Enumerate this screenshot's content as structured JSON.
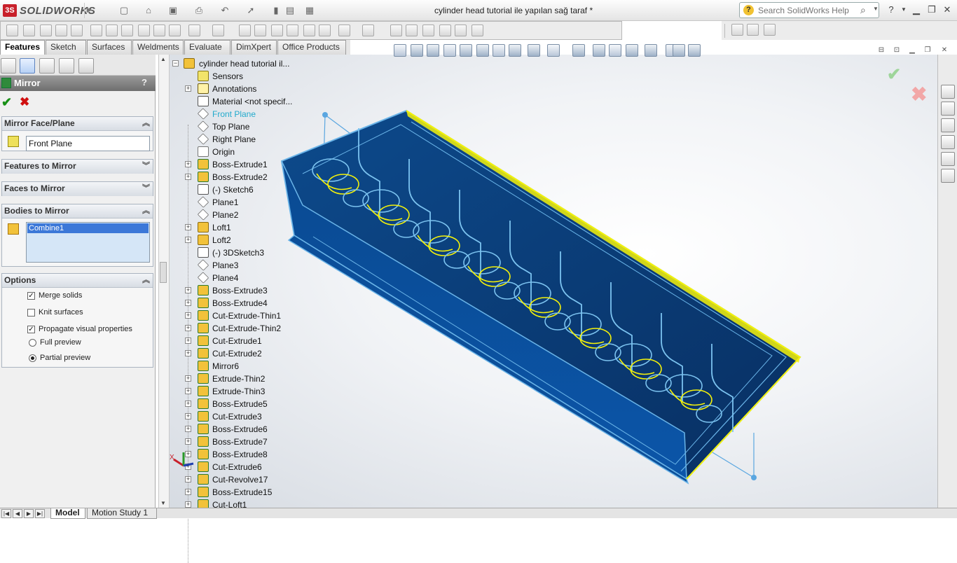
{
  "app": {
    "name": "SOLIDWORKS",
    "logo_mark": "3S"
  },
  "window": {
    "document_title": "cylinder head tutorial ile yapılan sağ taraf *"
  },
  "search": {
    "placeholder": "Search SolidWorks Help"
  },
  "tabs": [
    {
      "label": "Features",
      "active": true
    },
    {
      "label": "Sketch"
    },
    {
      "label": "Surfaces"
    },
    {
      "label": "Weldments"
    },
    {
      "label": "Evaluate"
    },
    {
      "label": "DimXpert"
    },
    {
      "label": "Office Products"
    }
  ],
  "property_manager": {
    "title": "Mirror",
    "help": "?",
    "ok_symbol": "✔",
    "cancel_symbol": "✖",
    "groups": {
      "mirror_face_plane": {
        "label": "Mirror Face/Plane",
        "value": "Front Plane"
      },
      "features_to_mirror": {
        "label": "Features to Mirror"
      },
      "faces_to_mirror": {
        "label": "Faces to Mirror"
      },
      "bodies_to_mirror": {
        "label": "Bodies to Mirror",
        "items": [
          "Combine1"
        ]
      },
      "options": {
        "label": "Options",
        "merge_solids": {
          "label": "Merge solids",
          "checked": true
        },
        "knit_surfaces": {
          "label": "Knit surfaces",
          "checked": false
        },
        "propagate_visual": {
          "label": "Propagate visual properties",
          "checked": true
        },
        "full_preview": {
          "label": "Full preview",
          "selected": false
        },
        "partial_preview": {
          "label": "Partial preview",
          "selected": true
        }
      }
    }
  },
  "tree": {
    "root": "cylinder head tutorial il...",
    "nodes": [
      {
        "label": "Sensors",
        "expand": false,
        "icon": "sensor-icon"
      },
      {
        "label": "Annotations",
        "expand": true,
        "icon": "annotations-icon"
      },
      {
        "label": "Material <not specif...",
        "expand": false,
        "icon": "material-icon"
      },
      {
        "label": "Front Plane",
        "expand": false,
        "icon": "plane-icon",
        "highlight": true
      },
      {
        "label": "Top Plane",
        "expand": false,
        "icon": "plane-icon"
      },
      {
        "label": "Right Plane",
        "expand": false,
        "icon": "plane-icon"
      },
      {
        "label": "Origin",
        "expand": false,
        "icon": "origin-icon"
      },
      {
        "label": "Boss-Extrude1",
        "expand": true,
        "icon": "boss-extrude-icon"
      },
      {
        "label": "Boss-Extrude2",
        "expand": true,
        "icon": "boss-extrude-icon"
      },
      {
        "label": "(-) Sketch6",
        "expand": false,
        "icon": "sketch-icon"
      },
      {
        "label": "Plane1",
        "expand": false,
        "icon": "plane-icon"
      },
      {
        "label": "Plane2",
        "expand": false,
        "icon": "plane-icon"
      },
      {
        "label": "Loft1",
        "expand": true,
        "icon": "loft-icon"
      },
      {
        "label": "Loft2",
        "expand": true,
        "icon": "loft-icon"
      },
      {
        "label": "(-) 3DSketch3",
        "expand": false,
        "icon": "3dsketch-icon"
      },
      {
        "label": "Plane3",
        "expand": false,
        "icon": "plane-icon"
      },
      {
        "label": "Plane4",
        "expand": false,
        "icon": "plane-icon"
      },
      {
        "label": "Boss-Extrude3",
        "expand": true,
        "icon": "boss-extrude-icon"
      },
      {
        "label": "Boss-Extrude4",
        "expand": true,
        "icon": "boss-extrude-icon"
      },
      {
        "label": "Cut-Extrude-Thin1",
        "expand": true,
        "icon": "cut-extrude-icon"
      },
      {
        "label": "Cut-Extrude-Thin2",
        "expand": true,
        "icon": "cut-extrude-icon"
      },
      {
        "label": "Cut-Extrude1",
        "expand": true,
        "icon": "cut-extrude-icon"
      },
      {
        "label": "Cut-Extrude2",
        "expand": true,
        "icon": "cut-extrude-icon"
      },
      {
        "label": "Mirror6",
        "expand": false,
        "icon": "mirror-icon"
      },
      {
        "label": "Extrude-Thin2",
        "expand": true,
        "icon": "boss-extrude-icon"
      },
      {
        "label": "Extrude-Thin3",
        "expand": true,
        "icon": "boss-extrude-icon"
      },
      {
        "label": "Boss-Extrude5",
        "expand": true,
        "icon": "boss-extrude-icon"
      },
      {
        "label": "Cut-Extrude3",
        "expand": true,
        "icon": "cut-extrude-icon"
      },
      {
        "label": "Boss-Extrude6",
        "expand": true,
        "icon": "boss-extrude-icon"
      },
      {
        "label": "Boss-Extrude7",
        "expand": true,
        "icon": "boss-extrude-icon"
      },
      {
        "label": "Boss-Extrude8",
        "expand": true,
        "icon": "boss-extrude-icon"
      },
      {
        "label": "Cut-Extrude6",
        "expand": true,
        "icon": "cut-extrude-icon"
      },
      {
        "label": "Cut-Revolve17",
        "expand": true,
        "icon": "cut-revolve-icon"
      },
      {
        "label": "Boss-Extrude15",
        "expand": true,
        "icon": "boss-extrude-icon"
      },
      {
        "label": "Cut-Loft1",
        "expand": true,
        "icon": "cut-loft-icon"
      }
    ]
  },
  "triad": {
    "x_label": "X"
  },
  "bottom_tabs": [
    {
      "label": "Model",
      "active": true
    },
    {
      "label": "Motion Study 1"
    }
  ],
  "colors": {
    "model_fill": "#0a3f7c",
    "model_edge": "#6ab4e8",
    "selection_yellow": "#f4f20a",
    "highlight_text": "#22aacc"
  }
}
